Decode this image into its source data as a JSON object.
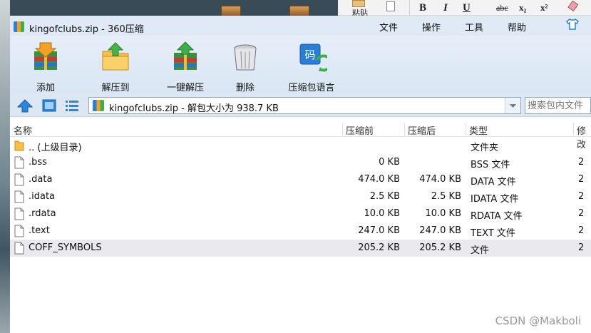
{
  "word_ribbon": {
    "paste_label": "粘贴",
    "bold": "B",
    "italic": "I",
    "underline": "U",
    "strike": "abc",
    "subscript": "x₂",
    "superscript": "x²"
  },
  "window": {
    "title": "kingofclubs.zip - 360压缩",
    "menu": [
      "文件",
      "操作",
      "工具",
      "帮助"
    ]
  },
  "toolbar": {
    "buttons": [
      "添加",
      "解压到",
      "一键解压",
      "删除",
      "压缩包语言"
    ]
  },
  "address": {
    "path": "kingofclubs.zip - 解包大小为 938.7 KB",
    "search_placeholder": "搜索包内文件"
  },
  "columns": {
    "name": "名称",
    "packed": "压缩前",
    "unpacked": "压缩后",
    "type": "类型",
    "modified": "修改"
  },
  "rows": [
    {
      "name": ".. (上级目录)",
      "packed": "",
      "unpacked": "",
      "type": "文件夹",
      "modified": ""
    },
    {
      "name": ".bss",
      "packed": "0 KB",
      "unpacked": "",
      "type": "BSS 文件",
      "modified": "2"
    },
    {
      "name": ".data",
      "packed": "474.0 KB",
      "unpacked": "474.0 KB",
      "type": "DATA 文件",
      "modified": "2"
    },
    {
      "name": ".idata",
      "packed": "2.5 KB",
      "unpacked": "2.5 KB",
      "type": "IDATA 文件",
      "modified": "2"
    },
    {
      "name": ".rdata",
      "packed": "10.0 KB",
      "unpacked": "10.0 KB",
      "type": "RDATA 文件",
      "modified": "2"
    },
    {
      "name": ".text",
      "packed": "247.0 KB",
      "unpacked": "247.0 KB",
      "type": "TEXT 文件",
      "modified": "2"
    },
    {
      "name": "COFF_SYMBOLS",
      "packed": "205.2 KB",
      "unpacked": "205.2 KB",
      "type": "文件",
      "modified": "2"
    }
  ],
  "watermark": "CSDN @Makboli",
  "colors": {
    "titlebar": "#dfeaf6",
    "toolbar": "#dae6f4",
    "selected_row": "#e9e9ee"
  }
}
